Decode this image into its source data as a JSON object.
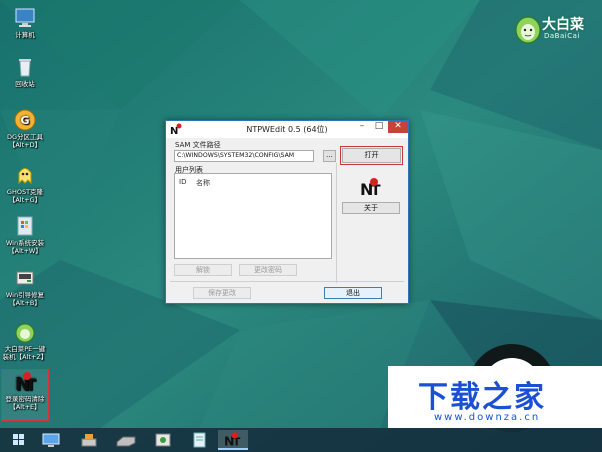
{
  "desktop": {
    "icons": [
      {
        "name": "计算机",
        "hotkey": ""
      },
      {
        "name": "回收站",
        "hotkey": ""
      },
      {
        "name": "DG分区工具",
        "hotkey": "【Alt+D】"
      },
      {
        "name": "GHOST克隆",
        "hotkey": "【Alt+G】"
      },
      {
        "name": "Win系统安装",
        "hotkey": "【Alt+W】"
      },
      {
        "name": "Win引导修复",
        "hotkey": "【Alt+B】"
      },
      {
        "name": "大白菜PE一键",
        "hotkey": "装机【Alt+Z】"
      },
      {
        "name": "登录密码清除",
        "hotkey": "【Alt+E】"
      }
    ]
  },
  "brand": {
    "name": "大白菜",
    "sub": "DaBaiCai"
  },
  "window": {
    "title": "NTPWEdit 0.5 (64位)",
    "minimize": "–",
    "maximize": "□",
    "close": "✕",
    "sam_label": "SAM 文件路径",
    "sam_path": "C:\\WINDOWS\\SYSTEM32\\CONFIG\\SAM",
    "browse": "...",
    "open": "打开",
    "user_list_label": "用户列表",
    "col_id": "ID",
    "col_name": "名称",
    "about": "关于",
    "unlock": "解锁",
    "change_password": "更改密码",
    "save_changes": "保存更改",
    "exit": "退出"
  },
  "watermark": {
    "main": "下载之家",
    "url": "www.downza.cn"
  },
  "colors": {
    "accent_red": "#c0393b",
    "title_close": "#c7423a",
    "desktop_teal": "#1f6f6a",
    "watermark_blue": "#1a4fd6"
  }
}
